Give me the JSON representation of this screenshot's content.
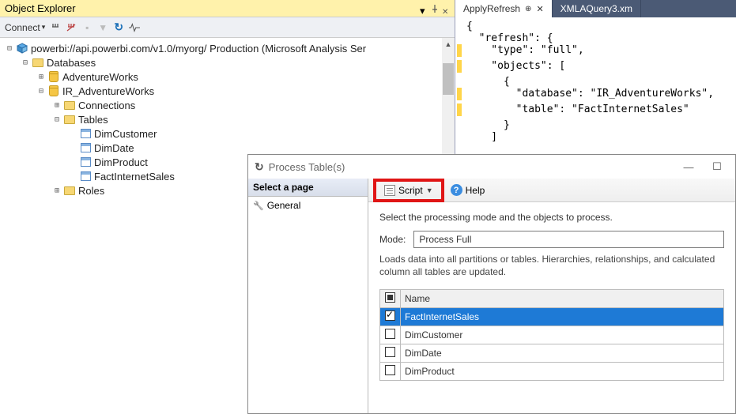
{
  "object_explorer": {
    "title": "Object Explorer",
    "connect_label": "Connect",
    "root": "powerbi://api.powerbi.com/v1.0/myorg/ Production (Microsoft Analysis Ser",
    "nodes": {
      "databases": "Databases",
      "adventureworks": "AdventureWorks",
      "ir_adventureworks": "IR_AdventureWorks",
      "connections": "Connections",
      "tables": "Tables",
      "dimcustomer": "DimCustomer",
      "dimdate": "DimDate",
      "dimproduct": "DimProduct",
      "factinternetsales": "FactInternetSales",
      "roles": "Roles"
    }
  },
  "editor": {
    "tabs": {
      "applyrefresh": "ApplyRefresh",
      "xmlaquery": "XMLAQuery3.xm"
    },
    "code": {
      "l1": "{",
      "l2": "  \"refresh\": {",
      "l3": "    \"type\": \"full\",",
      "l4": "    \"objects\": [",
      "l5": "      {",
      "l6": "        \"database\": \"IR_AdventureWorks\",",
      "l7": "        \"table\": \"FactInternetSales\"",
      "l8": "      }",
      "l9": "    ]"
    }
  },
  "dialog": {
    "title": "Process Table(s)",
    "select_page": "Select a page",
    "general": "General",
    "script_label": "Script",
    "help_label": "Help",
    "instruction": "Select the processing mode and the objects to process.",
    "mode_label": "Mode:",
    "mode_value": "Process Full",
    "mode_desc": "Loads data into all partitions or tables. Hierarchies, relationships, and calculated column all tables are updated.",
    "name_header": "Name",
    "rows": {
      "r0": "FactInternetSales",
      "r1": "DimCustomer",
      "r2": "DimDate",
      "r3": "DimProduct"
    }
  }
}
